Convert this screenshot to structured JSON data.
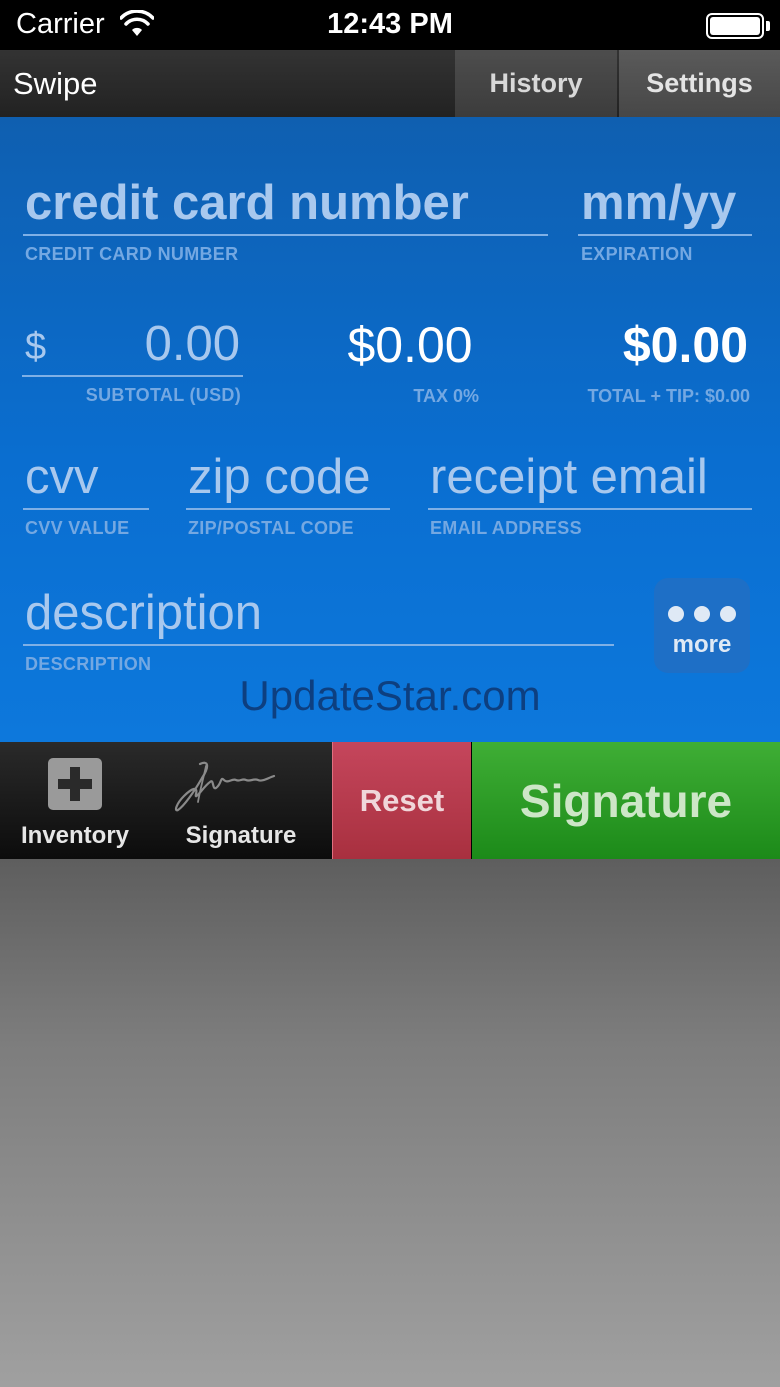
{
  "status_bar": {
    "carrier": "Carrier",
    "time": "12:43 PM",
    "battery_level": 1.0
  },
  "nav": {
    "title": "Swipe",
    "tabs": [
      "History",
      "Settings"
    ]
  },
  "form": {
    "card_number": {
      "placeholder": "credit card number",
      "caption": "CREDIT CARD NUMBER"
    },
    "expiration": {
      "placeholder": "mm/yy",
      "caption": "EXPIRATION"
    },
    "subtotal": {
      "currency_symbol": "$",
      "value": "0.00",
      "caption": "SUBTOTAL (USD)"
    },
    "tax": {
      "value": "$0.00",
      "caption": "TAX 0%"
    },
    "total": {
      "value": "$0.00",
      "caption": "TOTAL + TIP: $0.00"
    },
    "cvv": {
      "placeholder": "cvv",
      "caption": "CVV VALUE"
    },
    "zip": {
      "placeholder": "zip code",
      "caption": "ZIP/POSTAL CODE"
    },
    "email": {
      "placeholder": "receipt email",
      "caption": "EMAIL ADDRESS"
    },
    "description": {
      "placeholder": "description",
      "caption": "DESCRIPTION"
    },
    "more_label": "more"
  },
  "watermark": "UpdateStar.com",
  "toolbar": {
    "inventory_label": "Inventory",
    "signature_label": "Signature",
    "reset_label": "Reset",
    "signature_button_label": "Signature"
  },
  "icons": {
    "wifi": "wifi-icon",
    "battery": "battery-icon",
    "plus": "plus-box-icon",
    "signature": "signature-scribble-icon",
    "more": "ellipsis-icon"
  },
  "colors": {
    "panel_blue": "#0a6ed0",
    "reset_red": "#b83a4e",
    "signature_green": "#2a9a25"
  }
}
